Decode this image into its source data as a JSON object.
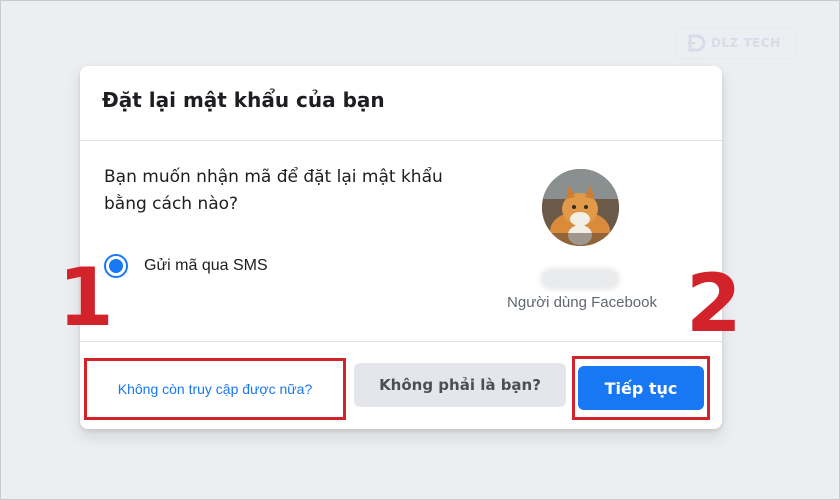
{
  "watermark": {
    "text": "DLZ TECH"
  },
  "dialog": {
    "title": "Đặt lại mật khẩu của bạn",
    "question": "Bạn muốn nhận mã để đặt lại mật khẩu bằng cách nào?",
    "option": {
      "label": "Gửi mã qua SMS",
      "selected": true
    },
    "user": {
      "role": "Người dùng Facebook"
    },
    "link_no_access": "Không còn truy cập được nữa?",
    "not_you_button": "Không phải là bạn?",
    "continue_button": "Tiếp tục"
  },
  "annotations": {
    "step1": "1",
    "step2": "2"
  },
  "colors": {
    "accent": "#1877f2",
    "highlight": "#d2232a",
    "secondary_button": "#e4e6eb"
  }
}
